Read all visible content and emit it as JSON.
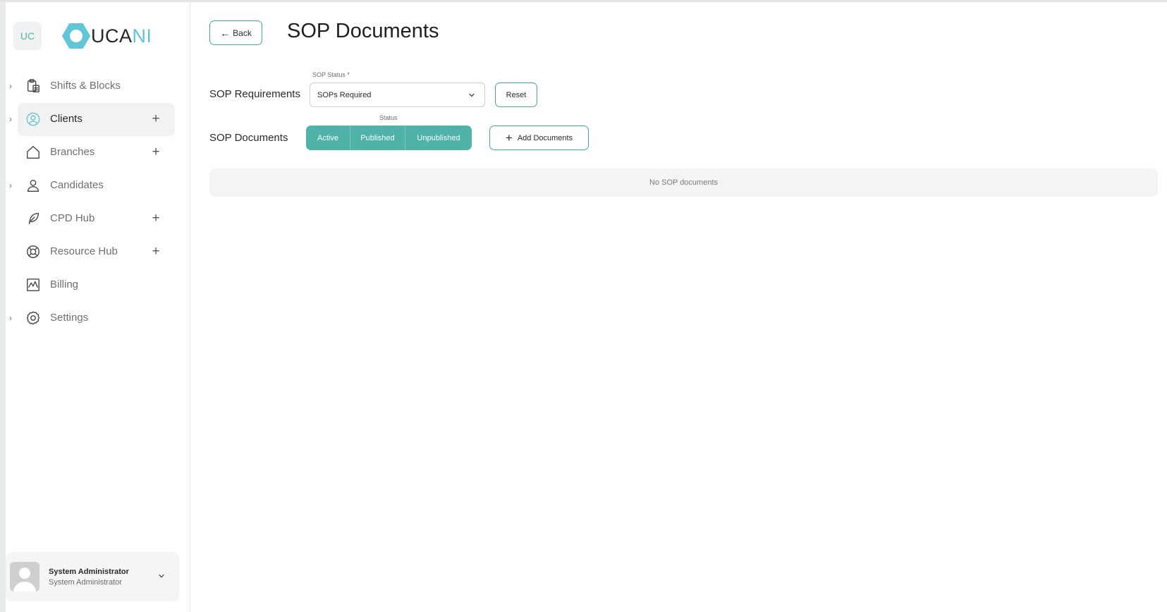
{
  "sidebar": {
    "badge": "UC",
    "logo": {
      "primary": "UCA",
      "accent": "NI",
      "accent_color": "#5fc7d7"
    },
    "items": [
      {
        "label": "Shifts & Blocks",
        "icon": "clipboard-icon",
        "chevron": true,
        "plus": false
      },
      {
        "label": "Clients",
        "icon": "user-circle-icon",
        "chevron": true,
        "plus": true,
        "active": true
      },
      {
        "label": "Branches",
        "icon": "home-icon",
        "chevron": false,
        "plus": true
      },
      {
        "label": "Candidates",
        "icon": "user-icon",
        "chevron": true,
        "plus": false
      },
      {
        "label": "CPD Hub",
        "icon": "feather-icon",
        "chevron": false,
        "plus": true
      },
      {
        "label": "Resource Hub",
        "icon": "lifebuoy-icon",
        "chevron": false,
        "plus": true
      },
      {
        "label": "Billing",
        "icon": "activity-chart-icon",
        "chevron": false,
        "plus": false
      },
      {
        "label": "Settings",
        "icon": "gear-icon",
        "chevron": true,
        "plus": false
      }
    ],
    "user": {
      "name": "System Administrator",
      "role": "System Administrator"
    }
  },
  "header": {
    "back_label": "Back",
    "title": "SOP Documents"
  },
  "requirements": {
    "label": "SOP Requirements",
    "select_label": "SOP Status *",
    "select_value": "SOPs Required",
    "reset_label": "Reset"
  },
  "documents": {
    "label": "SOP Documents",
    "status_label": "Status",
    "segments": [
      "Active",
      "Published",
      "Unpublished"
    ],
    "add_label": "Add Documents",
    "empty_text": "No SOP documents"
  },
  "colors": {
    "accent": "#4fb3a8",
    "border_accent": "#4aa59c"
  }
}
